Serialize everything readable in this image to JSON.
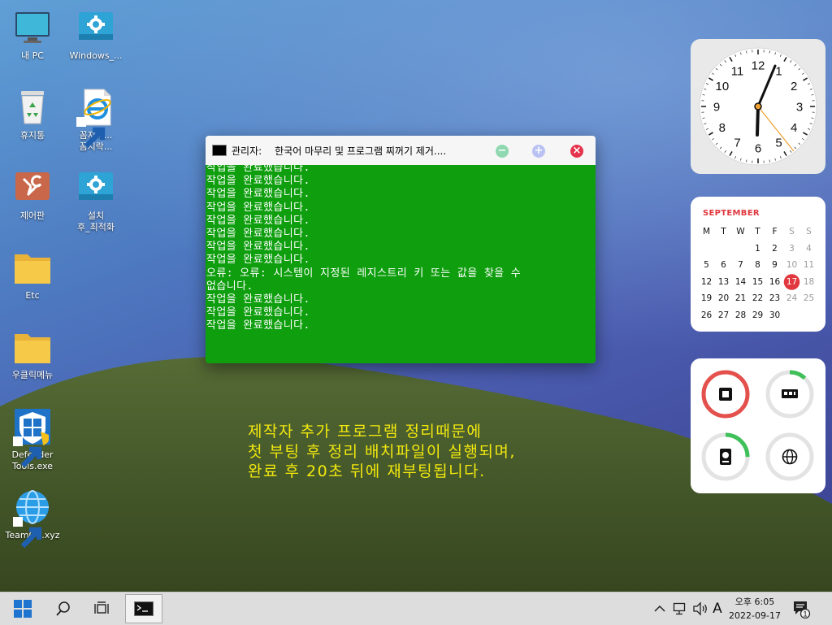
{
  "desktop_icons": [
    {
      "name": "this-pc",
      "label_lines": [
        "내 PC"
      ]
    },
    {
      "name": "windows-settings",
      "label_lines": [
        "Windows_..."
      ]
    },
    {
      "name": "recycle-bin",
      "label_lines": [
        "휴지통"
      ]
    },
    {
      "name": "ie-shortcut",
      "label_lines": [
        "꼼지락...",
        "꼼지락..."
      ]
    },
    {
      "name": "control-panel",
      "label_lines": [
        "제어판"
      ]
    },
    {
      "name": "setup-optimize",
      "label_lines": [
        "설치",
        "후_최적화"
      ]
    },
    {
      "name": "etc-folder",
      "label_lines": [
        "Etc"
      ]
    },
    {
      "name": "right-click-menu-folder",
      "label_lines": [
        "우클릭메뉴"
      ]
    },
    {
      "name": "defender-tools",
      "label_lines": [
        "Defender",
        "Tools.exe"
      ]
    },
    {
      "name": "teamos-shortcut",
      "label_lines": [
        "TeamOS.xyz"
      ]
    }
  ],
  "cmd_window": {
    "title_admin": "관리자:",
    "title_name": "한국어 마무리 및 프로그램 찌꺼기 제거....",
    "lines": [
      "작업을 완료했습니다.",
      "작업을 완료했습니다.",
      "작업을 완료했습니다.",
      "작업을 완료했습니다.",
      "작업을 완료했습니다.",
      "작업을 완료했습니다.",
      "작업을 완료했습니다.",
      "작업을 완료했습니다.",
      "오류: 오류: 시스템이 지정된 레지스트리 키 또는 값을 찾을 수",
      "없습니다.",
      "작업을 완료했습니다.",
      "작업을 완료했습니다.",
      "작업을 완료했습니다."
    ],
    "colors": {
      "background": "#0e9e0e",
      "text": "#ffffff",
      "minimize": "#8fd8b0",
      "maximize": "#b9c2f2",
      "close": "#e5334d"
    }
  },
  "notice": {
    "lines": [
      "제작자 추가 프로그램 정리때문에",
      "첫 부팅 후 정리 배치파일이 실행되며,",
      "완료 후 20초 뒤에 재부팅됩니다."
    ],
    "color": "#f2e80e"
  },
  "clock_widget": {
    "numbers": [
      "12",
      "1",
      "2",
      "3",
      "4",
      "5",
      "6",
      "7",
      "8",
      "9",
      "10",
      "11"
    ],
    "time": "6:05",
    "second_hand_color": "#f0a030",
    "center_color": "#f0a030"
  },
  "calendar_widget": {
    "month": "SEPTEMBER",
    "weekdays": [
      "M",
      "T",
      "W",
      "T",
      "F",
      "S",
      "S"
    ],
    "weeks": [
      [
        "",
        "",
        "",
        "1",
        "2",
        "3",
        "4"
      ],
      [
        "5",
        "6",
        "7",
        "8",
        "9",
        "10",
        "11"
      ],
      [
        "12",
        "13",
        "14",
        "15",
        "16",
        "17",
        "18"
      ],
      [
        "19",
        "20",
        "21",
        "22",
        "23",
        "24",
        "25"
      ],
      [
        "26",
        "27",
        "28",
        "29",
        "30",
        "",
        ""
      ]
    ],
    "today": "17",
    "accent": "#e0383e"
  },
  "resource_widget": {
    "gauges": [
      {
        "name": "cpu",
        "icon": "cpu-icon",
        "usage_percent": 100,
        "color": "#e4514c"
      },
      {
        "name": "memory",
        "icon": "memory-icon",
        "usage_percent": 12,
        "color": "#3fc05a"
      },
      {
        "name": "disk",
        "icon": "disk-icon",
        "usage_percent": 25,
        "color": "#3fc05a"
      },
      {
        "name": "network",
        "icon": "globe-icon",
        "usage_percent": 0,
        "color": "#3fc05a"
      }
    ]
  },
  "taskbar": {
    "buttons": [
      {
        "name": "start",
        "icon": "windows-start-icon"
      },
      {
        "name": "search",
        "icon": "search-icon"
      },
      {
        "name": "task-view",
        "icon": "task-view-icon"
      },
      {
        "name": "cmd-app",
        "icon": "cmd-icon",
        "active": true
      }
    ],
    "tray": {
      "icons": [
        "chevron-up-icon",
        "network-icon",
        "volume-icon"
      ],
      "ime_label": "A",
      "time": "오후 6:05",
      "date": "2022-09-17",
      "notification_count": "1"
    }
  }
}
